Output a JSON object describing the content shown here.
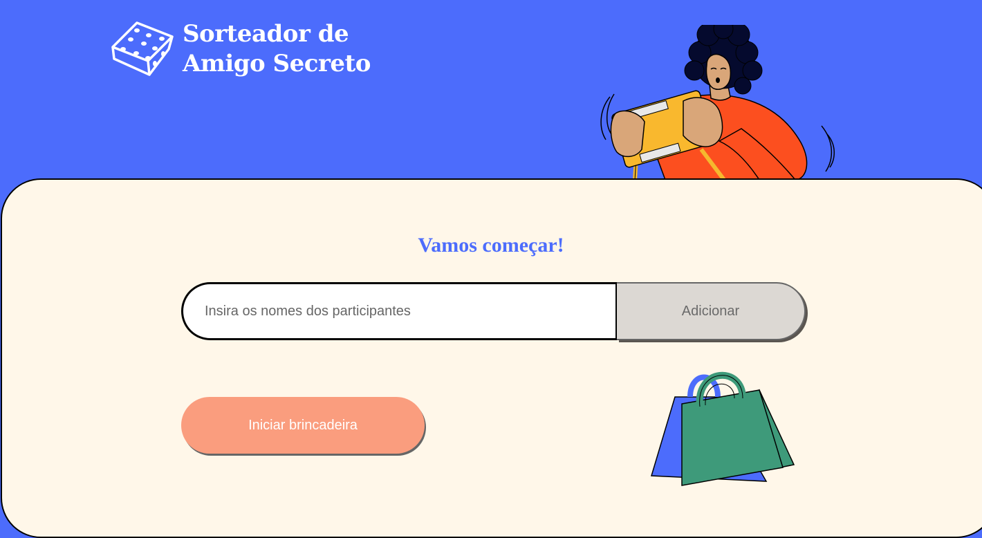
{
  "app": {
    "title_line1": "Sorteador de",
    "title_line2": "Amigo Secreto",
    "logo_icon": "dice-icon"
  },
  "main": {
    "heading": "Vamos começar!",
    "input_placeholder": "Insira os nomes dos participantes",
    "input_value": "",
    "add_button_label": "Adicionar",
    "start_button_label": "Iniciar brincadeira"
  },
  "illustrations": {
    "top": "girl-playing-game-illustration",
    "bottom": "shopping-bags-illustration"
  },
  "colors": {
    "brand_blue": "#4C6CFC",
    "card_background": "#FFF7E9",
    "start_button": "#FA9D7E",
    "add_button": "#DCD8D3",
    "heading": "#4C6CFC"
  }
}
